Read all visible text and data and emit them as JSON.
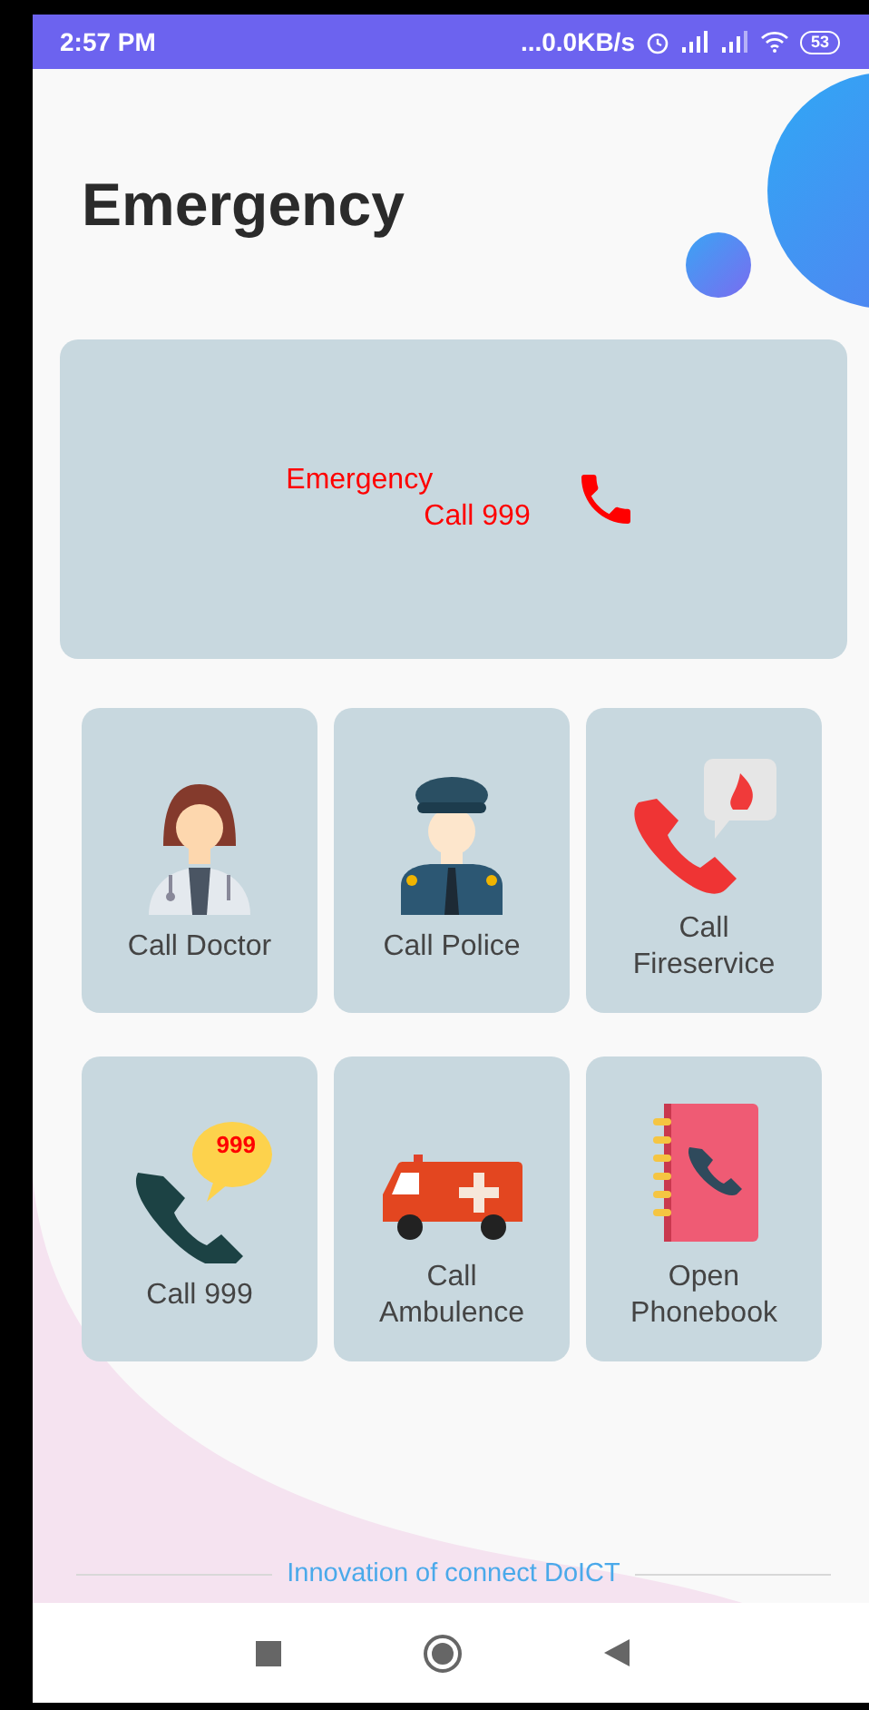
{
  "status_bar": {
    "time": "2:57 PM",
    "network_speed": "...0.0KB/s",
    "battery": "53"
  },
  "header": {
    "title": "Emergency"
  },
  "banner": {
    "line_1": "Emergency",
    "line_2": "Call 999"
  },
  "tiles": [
    {
      "kind": "doctor",
      "label": "Call Doctor"
    },
    {
      "kind": "police",
      "label": "Call Police"
    },
    {
      "kind": "fire",
      "label": "Call Fireservice"
    },
    {
      "kind": "call999",
      "label": "Call 999",
      "badge": "999"
    },
    {
      "kind": "ambulance",
      "label": "Call Ambulence"
    },
    {
      "kind": "phonebook",
      "label": "Open Phonebook"
    }
  ],
  "footer": {
    "credit": "Innovation of connect DoICT"
  }
}
